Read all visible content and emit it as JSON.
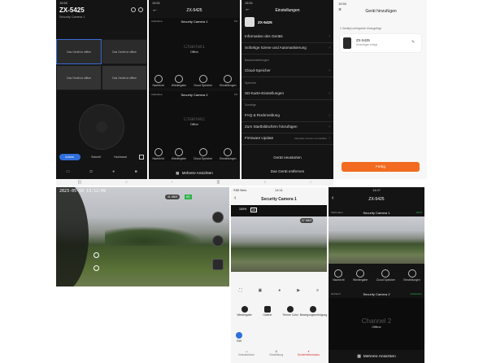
{
  "p1": {
    "status_time": "15:50",
    "title": "ZX-5425",
    "subtitle": "Security Camera 1",
    "cells": [
      "Das Gerät ist offline",
      "Das Gerät ist offline",
      "Das Gerät ist offline",
      "Das Gerät ist offline"
    ],
    "modes": [
      "Autom.",
      "Schnell",
      "Hochrand"
    ]
  },
  "p2": {
    "status_time": "15:51",
    "title": "ZX-5425",
    "cam1_header": "Security Camera 1",
    "cam1_left": "Aufnahme",
    "cam1_right": "0%",
    "channel1": "Channel1",
    "offline": "Offline",
    "cam2_header": "Security Camera 2",
    "cam2_left": "Aufnahme",
    "cam2_right": "0%",
    "channel2": "Channel2",
    "icons": [
      "Nachricht",
      "Wiedergabe",
      "Cloud Speicher",
      "Einstellungen"
    ],
    "more_views": "Mehrere Ansichten"
  },
  "p3": {
    "status_time": "15:51",
    "title": "Einstellungen",
    "device": "ZX-5425",
    "rows_a": [
      "Information des Geräts",
      "Sofortige Szene und Automatisierung"
    ],
    "sec_basic": "Basiseinstellungen",
    "rows_b": [
      "Cloud-Speicher"
    ],
    "sec_storage": "Speicher",
    "rows_c": [
      "SD-Karte-Einstellungen"
    ],
    "sec_other": "Sonstige",
    "rows_d": [
      "FAQ & Rückmeldung",
      "Zum Startbildschirm hinzufügen"
    ],
    "firmware_label": "Firmware Update",
    "firmware_value": "Aktuellste Version ist installiert",
    "restart": "Gerät neustarten",
    "remove": "Das Gerät entfernen"
  },
  "p4": {
    "status_time": "15:50",
    "title": "Gerät hinzufügen",
    "added": "1 Gerät(e) erfolgreich hinzugefügt",
    "device_name": "ZX-5425",
    "device_status": "Hinzufügen erfolgt",
    "done": "Fertig"
  },
  "p5": {
    "timestamp": "2023-05-10 13:12:09",
    "quality": "HD",
    "fps": "41 KB/S"
  },
  "p6": {
    "status_time": "14:11",
    "carrier": "SIM Netz",
    "title": "Security Camera 1",
    "battery": "100%",
    "badge": "HD",
    "speed": "37 KB/S",
    "tiles": [
      "Wiedergabe",
      "Galerie",
      "Theme Color",
      "Bewegungsverfolgung"
    ],
    "edit": "Edit",
    "tabs": [
      "Videofunktion",
      "Einstellung",
      "Sicherheitsmodus"
    ]
  },
  "p7": {
    "status_time": "14:07",
    "title": "ZX-5425",
    "cam1_header": "Security Camera 1",
    "cam1_left": "Verbunden",
    "cam1_right": "100%",
    "icons": [
      "Nachricht",
      "Wiedergabe",
      "Cloud Speicher",
      "Einstellungen"
    ],
    "cam2_header": "Security Camera 2",
    "cam2_left": "Getrennt",
    "cam2_right": "Aufwecken",
    "channel2": "Channel 2",
    "offline": "Offline",
    "more_views": "Mehrere Ansichten"
  },
  "colors": {
    "accent_orange": "#f26b21",
    "accent_green": "#2fb34a",
    "accent_red": "#d9342b"
  }
}
